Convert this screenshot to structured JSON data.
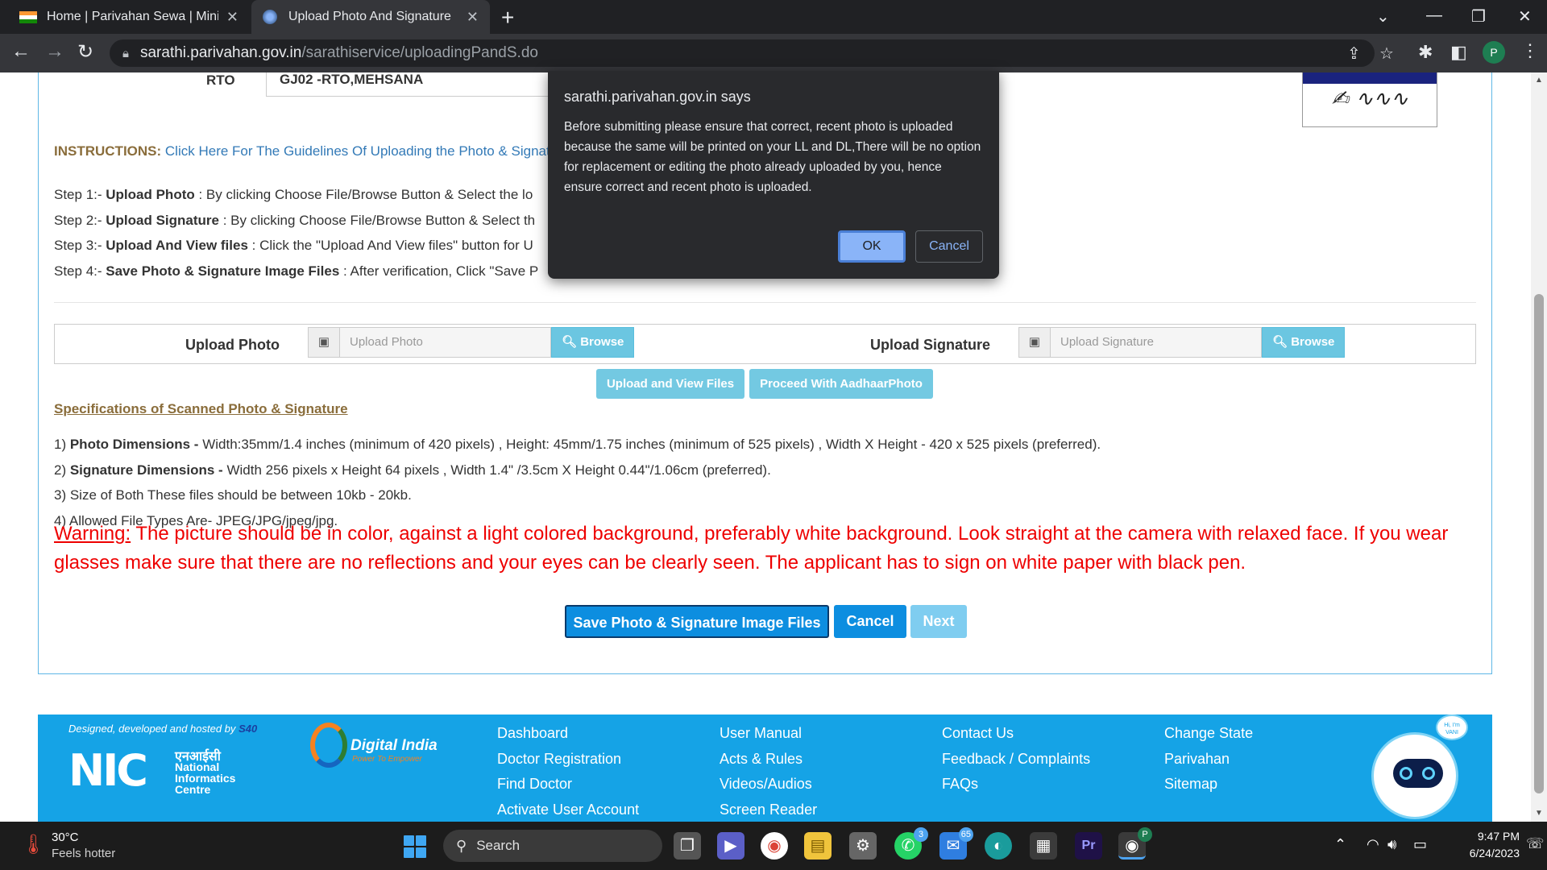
{
  "browser": {
    "tabs": [
      {
        "title": "Home | Parivahan Sewa | Ministry of Road Transport",
        "active": false
      },
      {
        "title": "Upload Photo And Signature",
        "active": true
      }
    ],
    "url_host": "sarathi.parivahan.gov.in",
    "url_path": "/sarathiservice/uploadingPandS.do",
    "profile_initial": "P"
  },
  "form": {
    "rto_label": "RTO",
    "rto_value": "GJ02 -RTO,MEHSANA",
    "instructions_label": "INSTRUCTIONS:",
    "instructions_link": "Click Here For The Guidelines Of Uploading the Photo & Signature",
    "steps": [
      {
        "prefix": "Step 1:- ",
        "bold": "Upload Photo",
        "text": " : By clicking Choose File/Browse Button & Select the lo"
      },
      {
        "prefix": "Step 2:- ",
        "bold": "Upload Signature",
        "text": " : By clicking Choose File/Browse Button & Select th"
      },
      {
        "prefix": "Step 3:- ",
        "bold": "Upload And View files",
        "text": " : Click the \"Upload And View files\" button for U"
      },
      {
        "prefix": "Step 4:- ",
        "bold": "Save Photo & Signature Image Files",
        "text": " : After verification, Click \"Save P"
      }
    ],
    "upload_photo_label": "Upload Photo",
    "upload_photo_placeholder": "Upload Photo",
    "upload_signature_label": "Upload Signature",
    "upload_signature_placeholder": "Upload Signature",
    "browse_label": "Browse",
    "upload_view_label": "Upload and View Files",
    "proceed_aadhaar_label": "Proceed With AadhaarPhoto",
    "spec_title": "Specifications of Scanned Photo & Signature",
    "specs": [
      {
        "prefix": "1) ",
        "bold": "Photo Dimensions -",
        "text": " Width:35mm/1.4 inches (minimum of 420 pixels) , Height: 45mm/1.75 inches (minimum of 525 pixels) , Width X Height - 420 x 525 pixels (preferred)."
      },
      {
        "prefix": "2) ",
        "bold": "Signature Dimensions -",
        "text": " Width 256 pixels x Height 64 pixels , Width 1.4\" /3.5cm X Height 0.44\"/1.06cm (preferred)."
      },
      {
        "prefix": "3) ",
        "bold": "",
        "text": "Size of Both These files should be between 10kb - 20kb."
      },
      {
        "prefix": "4) ",
        "bold": "",
        "text": "Allowed File Types Are- JPEG/JPG/jpeg/jpg."
      }
    ],
    "warning_label": "Warning:",
    "warning_text": " The picture should be in color, against a light colored background, preferably white background. Look straight at the camera with relaxed face. If you wear glasses make sure that there are no reflections and your eyes can be clearly seen. The applicant has to sign on white paper with black pen.",
    "save_label": "Save Photo & Signature Image Files",
    "cancel_label": "Cancel",
    "next_label": "Next"
  },
  "dialog": {
    "title": "sarathi.parivahan.gov.in says",
    "message": "Before submitting please ensure that correct, recent photo is uploaded because the same will be printed on your LL and DL,There will be no option for replacement or editing the photo already uploaded by you, hence ensure correct and recent photo is uploaded.",
    "ok_label": "OK",
    "cancel_label": "Cancel"
  },
  "footer": {
    "designed_by": "Designed, developed and hosted by",
    "designed_by_org": "S40",
    "nic_hindi": "एनआईसी",
    "nic_name": [
      "National",
      "Informatics",
      "Centre"
    ],
    "nic_letters": "NIC",
    "digital_india_title": "Digital India",
    "digital_india_tagline": "Power To Empower",
    "col1": [
      "Dashboard",
      "Doctor Registration",
      "Find Doctor",
      "Activate User Account"
    ],
    "col2": [
      "User Manual",
      "Acts & Rules",
      "Videos/Audios",
      "Screen Reader"
    ],
    "col3": [
      "Contact Us",
      "Feedback / Complaints",
      "FAQs"
    ],
    "col4": [
      "Change State",
      "Parivahan",
      "Sitemap"
    ],
    "chatbot_bubble": "Hi, I'm VANI"
  },
  "taskbar": {
    "temperature": "30°C",
    "weather_desc": "Feels hotter",
    "search_placeholder": "Search",
    "whatsapp_badge": "3",
    "mail_badge": "65",
    "chrome_badge": "P",
    "time": "9:47 PM",
    "date": "6/24/2023"
  },
  "colors": {
    "accent": "#15a3e6",
    "primary_button": "#0d8ee0",
    "info_button": "#5bc0de",
    "warning_text": "#e00000",
    "instructions_label": "#8a6d3b"
  }
}
